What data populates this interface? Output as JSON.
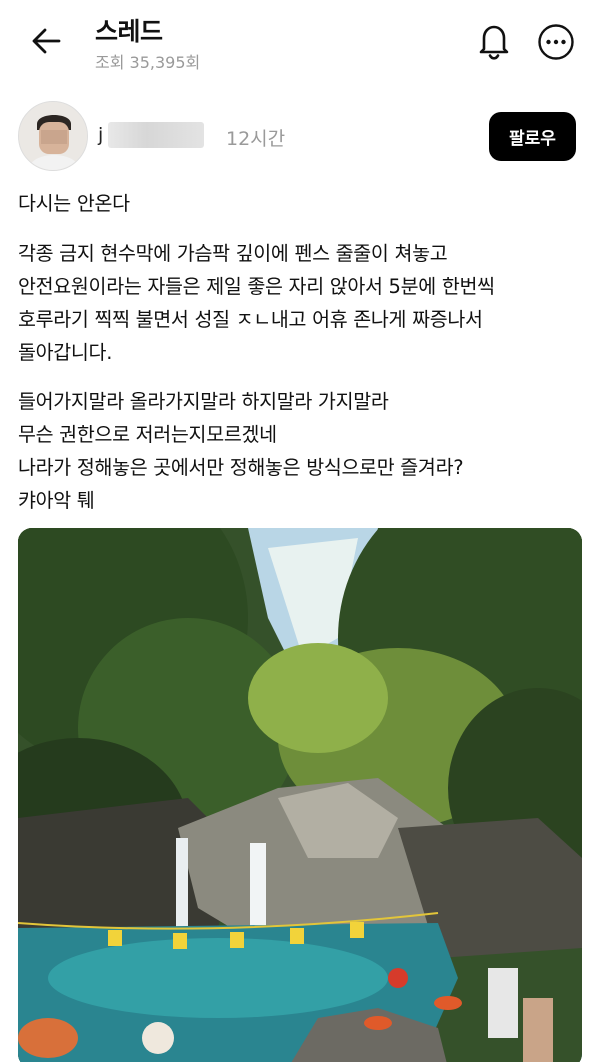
{
  "header": {
    "title": "스레드",
    "views": "조회 35,395회"
  },
  "post": {
    "username_visible": "j g",
    "timestamp": "12시간",
    "follow_label": "팔로우",
    "paragraphs": [
      "다시는 안온다",
      "각종 금지 현수막에 가슴팍 깊이에 펜스 줄줄이 쳐놓고\n안전요원이라는 자들은 제일 좋은 자리 앉아서 5분에 한번씩\n호루라기 찍찍 불면서 성질 ㅈㄴ내고 어휴 존나게 짜증나서\n돌아갑니다.",
      "들어가지말라 올라가지말라 하지말라 가지말라\n무슨 권한으로 저러는지모르겠네\n나라가 정해놓은 곳에서만 정해놓은 방식으로만 즐겨라?\n캬아악 퉤"
    ]
  },
  "colors": {
    "follow_button_bg": "#000000",
    "secondary_text": "#9a9a9a"
  },
  "icons": {
    "back": "arrow-left-icon",
    "notifications": "bell-icon",
    "more": "more-horizontal-icon"
  }
}
